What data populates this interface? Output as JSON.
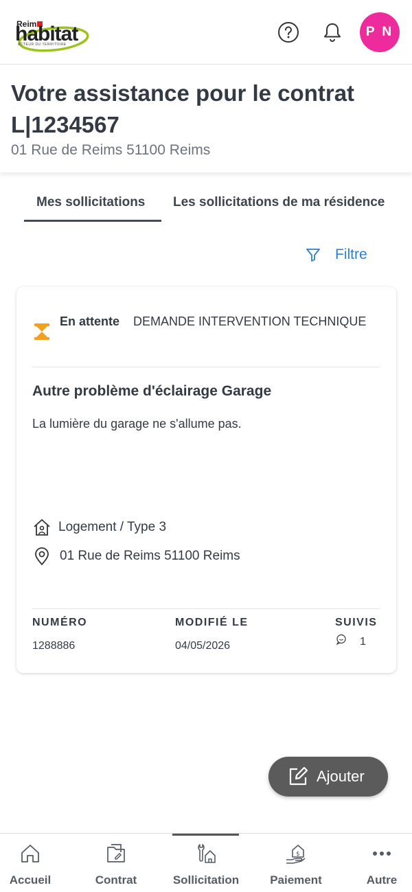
{
  "header": {
    "logo_top": "Reims",
    "logo_main": "habitat",
    "logo_sub": "ACTEUR DU TERRITOIRE",
    "avatar_initials": "P N"
  },
  "page": {
    "title": "Votre assistance pour le contrat L|1234567",
    "subtitle": "01 Rue de Reims 51100 Reims"
  },
  "tabs": [
    {
      "label": "Mes sollicitations",
      "active": true
    },
    {
      "label": "Les sollicitations de ma résidence",
      "active": false
    }
  ],
  "filter": {
    "label": "Filtre"
  },
  "request": {
    "status": "En attente",
    "type": "DEMANDE INTERVENTION TECHNIQUE",
    "title": "Autre problème d'éclairage Garage",
    "description": "La lumière du garage ne s'allume pas.",
    "housing": "Logement / Type 3",
    "address": "01 Rue de Reims 51100 Reims",
    "number_label": "NUMÉRO",
    "number_value": "1288886",
    "modified_label": "MODIFIÉ LE",
    "modified_value": "04/05/2026",
    "follow_label": "SUIVIS",
    "follow_value": "1"
  },
  "add_button": {
    "label": "Ajouter"
  },
  "nav": [
    {
      "label": "Accueil",
      "icon": "home-icon"
    },
    {
      "label": "Contrat",
      "icon": "contract-icon"
    },
    {
      "label": "Sollicitation",
      "icon": "wrench-house-icon",
      "active": true
    },
    {
      "label": "Paiement",
      "icon": "payment-icon"
    },
    {
      "label": "Autre",
      "icon": "more-icon"
    }
  ],
  "colors": {
    "accent_blue": "#2f7fcf",
    "avatar_pink": "#ee2b9c",
    "status_orange": "#f2a11d",
    "logo_green": "#9cc31c",
    "logo_red": "#d6282b"
  }
}
